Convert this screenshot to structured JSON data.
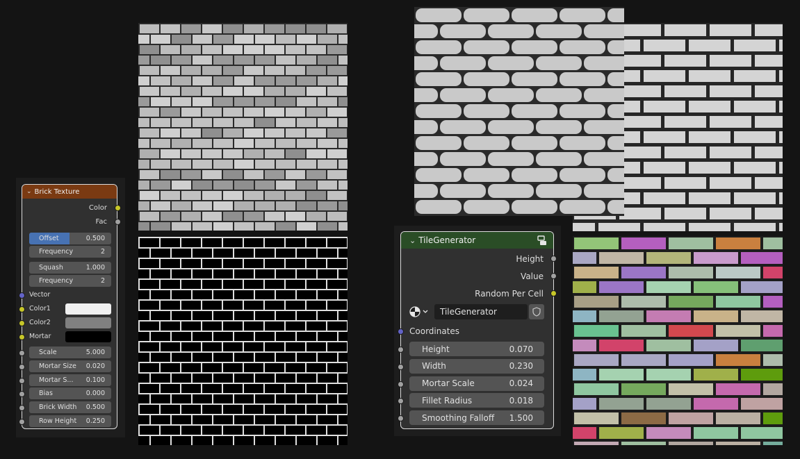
{
  "brick_node": {
    "title": "Brick Texture",
    "outputs": [
      "Color",
      "Fac"
    ],
    "offset": {
      "label": "Offset",
      "value": "0.500"
    },
    "offset_frequency": {
      "label": "Frequency",
      "value": "2"
    },
    "squash": {
      "label": "Squash",
      "value": "1.000"
    },
    "squash_frequency": {
      "label": "Frequency",
      "value": "2"
    },
    "vector_label": "Vector",
    "color1_label": "Color1",
    "color2_label": "Color2",
    "mortar_label": "Mortar",
    "color1": "#f0f0f0",
    "color2": "#808080",
    "mortar": "#000000",
    "header_color": "#7a3a12",
    "params": [
      {
        "label": "Scale",
        "value": "5.000"
      },
      {
        "label": "Mortar Size",
        "value": "0.020"
      },
      {
        "label": "Mortar S...",
        "value": "0.100"
      },
      {
        "label": "Bias",
        "value": "0.000"
      },
      {
        "label": "Brick Width",
        "value": "0.500"
      },
      {
        "label": "Row Height",
        "value": "0.250"
      }
    ]
  },
  "tile_node": {
    "title": "TileGenerator",
    "header_color": "#2a4d26",
    "outputs": [
      "Height",
      "Value",
      "Random Per Cell"
    ],
    "group_name": "TileGenerator",
    "coordinates_label": "Coordinates",
    "params": [
      {
        "label": "Height",
        "value": "0.070"
      },
      {
        "label": "Width",
        "value": "0.230"
      },
      {
        "label": "Mortar Scale",
        "value": "0.024"
      },
      {
        "label": "Fillet Radius",
        "value": "0.018"
      },
      {
        "label": "Smoothing Falloff",
        "value": "1.500"
      }
    ],
    "icons": [
      "chevron-down-icon",
      "node-tree-icon",
      "material-sphere-icon",
      "fake-user-shield-icon"
    ]
  },
  "socket_colors": {
    "color": "#c7c729",
    "float": "#a1a1a1",
    "vector": "#6363c7"
  }
}
